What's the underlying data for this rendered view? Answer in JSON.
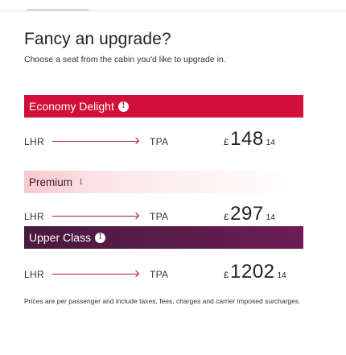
{
  "header": {
    "title": "Fancy an upgrade?",
    "subtitle": "Choose a seat from the cabin you'd like to upgrade in."
  },
  "cabins": [
    {
      "name": "Economy Delight",
      "info_icon": "info-icon",
      "origin": "LHR",
      "destination": "TPA",
      "currency_symbol": "£",
      "price_whole": "148",
      "price_fraction": "14",
      "color": "#d10f3a"
    },
    {
      "name": "Premium",
      "info_glyph": "i",
      "info_icon": "info-icon",
      "origin": "LHR",
      "destination": "TPA",
      "currency_symbol": "£",
      "price_whole": "297",
      "price_fraction": "14",
      "color": "#f7c9cf"
    },
    {
      "name": "Upper Class",
      "info_icon": "info-icon",
      "origin": "LHR",
      "destination": "TPA",
      "currency_symbol": "£",
      "price_whole": "1202",
      "price_fraction": "14",
      "color": "#4a1a3e"
    }
  ],
  "footer": {
    "disclaimer": "Prices are per passenger and include taxes, fees, charges and carrier imposed surcharges."
  }
}
